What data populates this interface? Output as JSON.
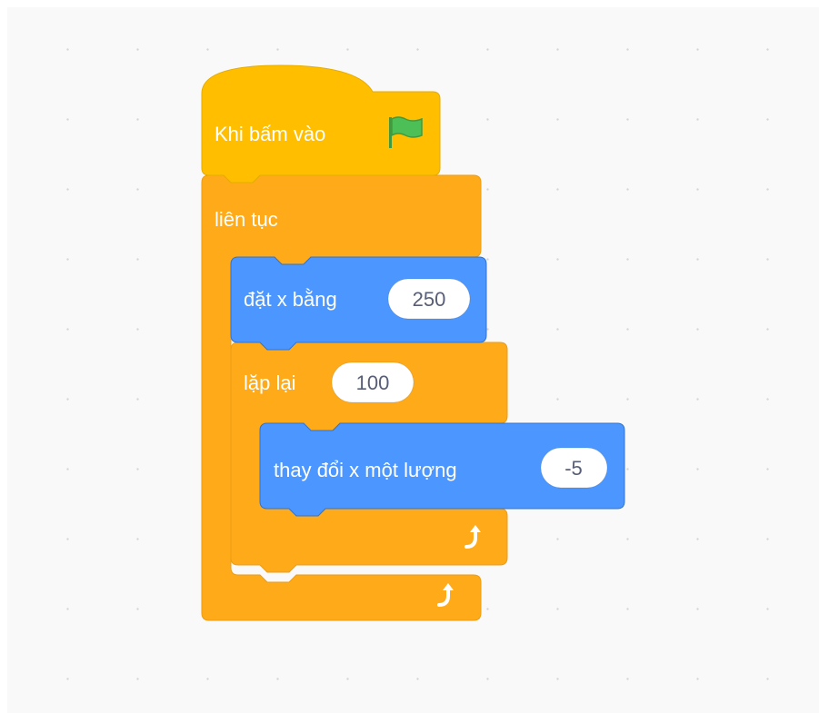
{
  "workspace": {
    "background_color": "#f9f9f9",
    "dot_color": "#d6d6d6"
  },
  "script": {
    "hat_block": {
      "label": "Khi bấm vào",
      "icon": "green-flag-icon",
      "color": "#ffbf00"
    },
    "forever_block": {
      "label": "liên tục",
      "loop_icon": "loop-arrow-icon",
      "color": "#ffab19"
    },
    "set_x_block": {
      "label": "đặt x bằng",
      "value": "250",
      "color": "#4c97ff"
    },
    "repeat_block": {
      "label": "lặp lại",
      "value": "100",
      "loop_icon": "loop-arrow-icon",
      "color": "#ffab19"
    },
    "change_x_block": {
      "label": "thay đổi x một lượng",
      "value": "-5",
      "color": "#4c97ff"
    }
  }
}
